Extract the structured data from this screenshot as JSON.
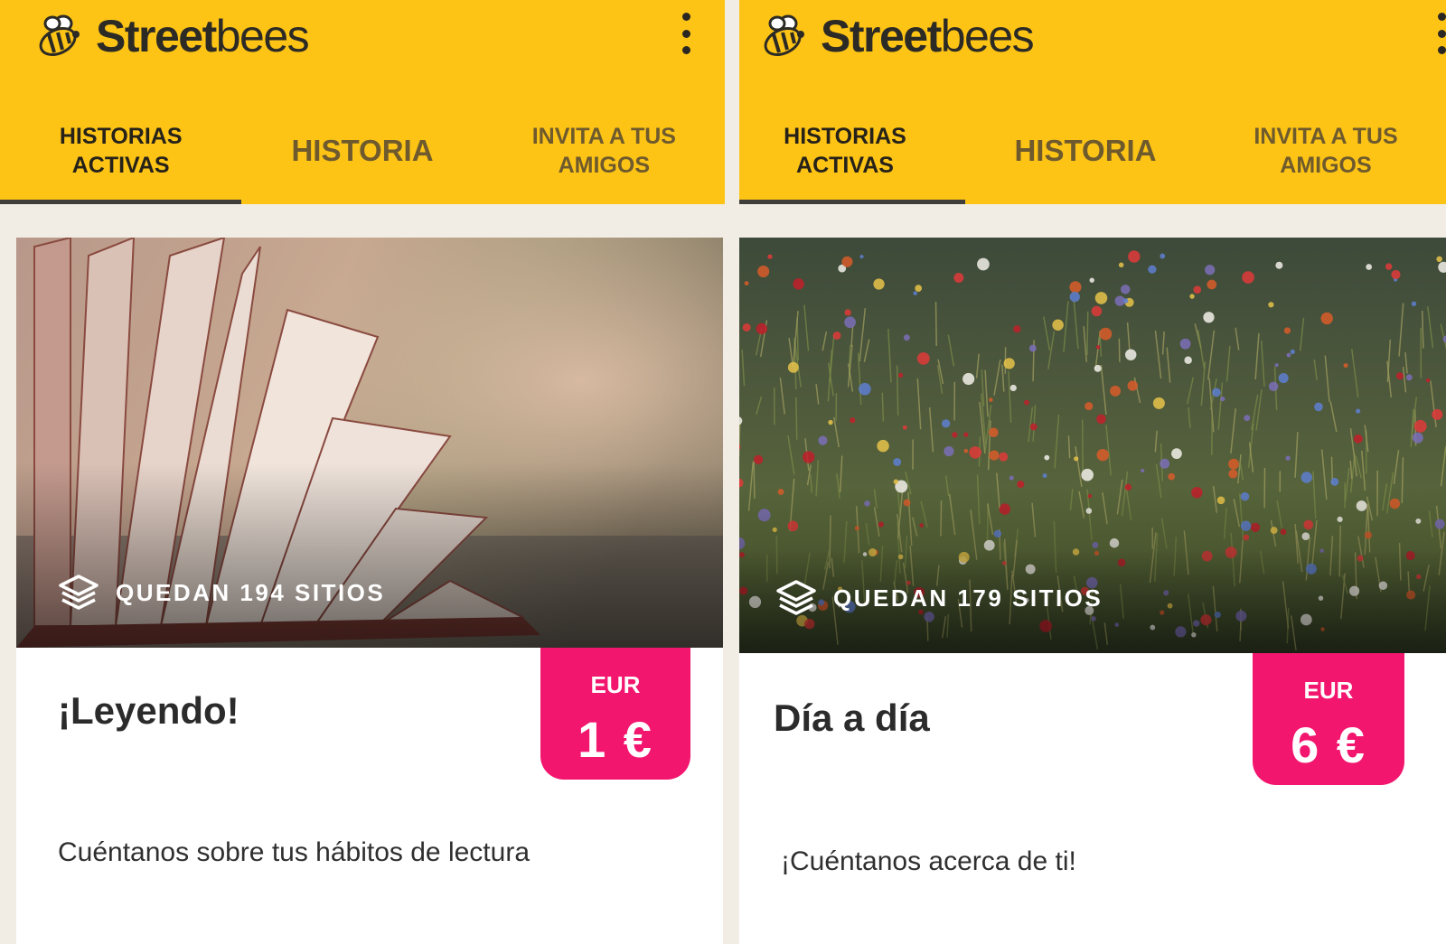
{
  "brand": {
    "bold": "Street",
    "light": "bees"
  },
  "tabs": [
    {
      "label": "HISTORIAS\nACTIVAS",
      "active": true
    },
    {
      "label": "HISTORIA",
      "active": false
    },
    {
      "label": "INVITA A TUS\nAMIGOS",
      "active": false
    }
  ],
  "cards": [
    {
      "image": "open-book-photo",
      "slots": "QUEDAN 194 SITIOS",
      "currency": "EUR",
      "amount": "1 €",
      "title": "¡Leyendo!",
      "description": "Cuéntanos sobre tus hábitos de lectura"
    },
    {
      "image": "wildflower-meadow-photo",
      "slots": "QUEDAN 179 SITIOS",
      "currency": "EUR",
      "amount": "6 €",
      "title": "Día a día",
      "description": "¡Cuéntanos acerca de ti!"
    }
  ],
  "colors": {
    "appbar": "#fdc416",
    "price_badge": "#f2166e",
    "background": "#f1ede5"
  }
}
